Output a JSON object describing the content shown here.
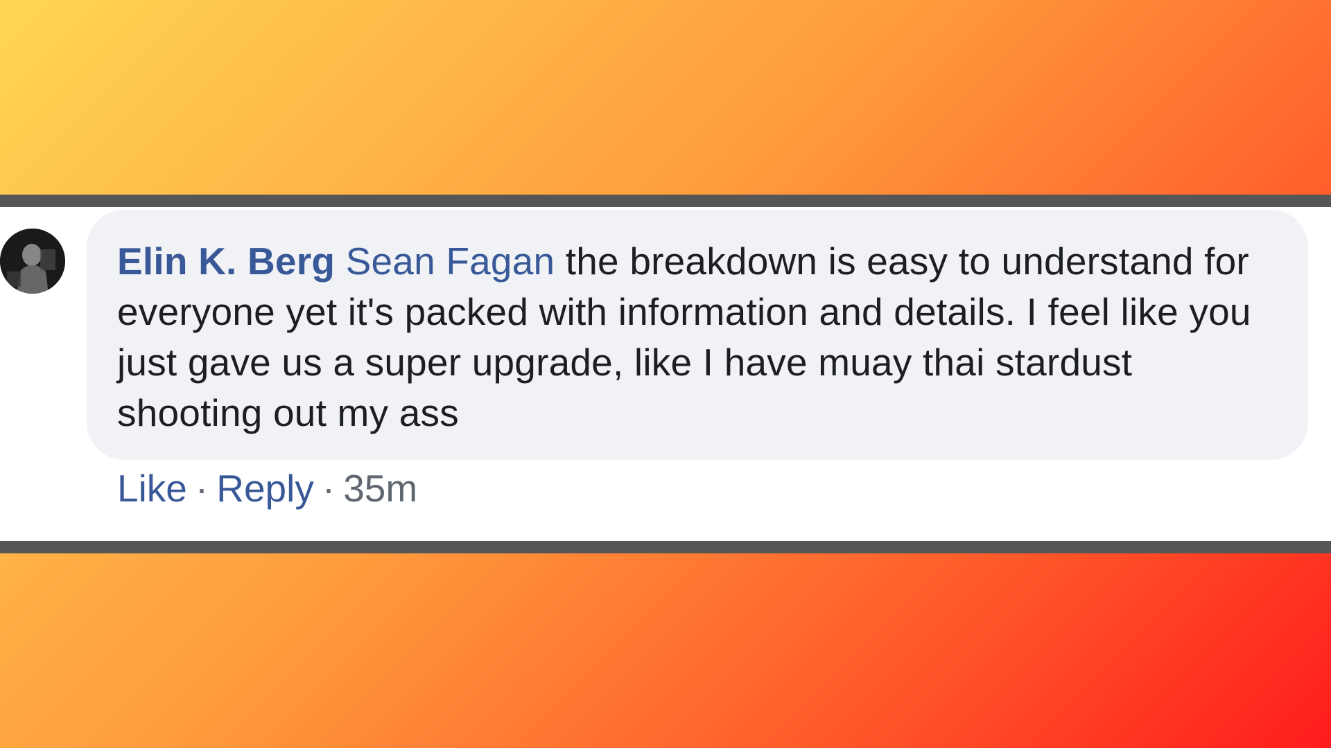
{
  "comment": {
    "author": "Elin K. Berg",
    "mention": "Sean Fagan",
    "body": "the breakdown is easy to understand for everyone yet it's packed with information and details. I feel like you just gave us a super upgrade, like I have muay thai stardust shooting out my ass",
    "avatar_icon": "user-avatar-icon"
  },
  "actions": {
    "like_label": "Like",
    "reply_label": "Reply",
    "separator": "·",
    "timestamp": "35m"
  },
  "colors": {
    "link_blue": "#385898",
    "bubble_bg": "#f0f2f5",
    "meta_gray": "#606770",
    "divider": "#565656",
    "gradient_start": "#ffd654",
    "gradient_end": "#ff1c1c"
  }
}
